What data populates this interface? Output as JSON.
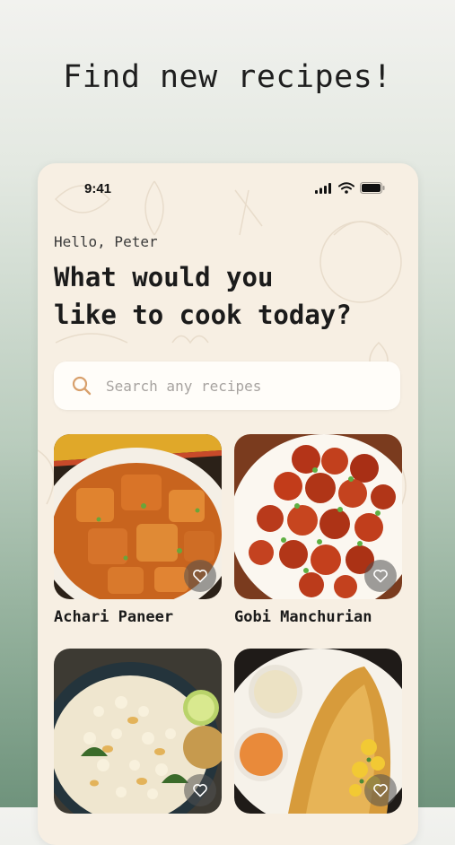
{
  "headline": "Find new recipes!",
  "status": {
    "time": "9:41"
  },
  "greeting": "Hello, Peter",
  "prompt_line1": "What would you",
  "prompt_line2": "like to cook today?",
  "search": {
    "placeholder": "Search any recipes"
  },
  "recipes": [
    {
      "name": "Achari Paneer"
    },
    {
      "name": "Gobi Manchurian"
    },
    {
      "name": ""
    },
    {
      "name": ""
    }
  ],
  "icons": {
    "search": "search-icon",
    "favorite": "heart-outline-icon",
    "signal": "cellular-signal-icon",
    "wifi": "wifi-icon",
    "battery": "battery-icon"
  },
  "colors": {
    "card_background": "#f7efe3",
    "search_icon": "#d8a06c",
    "text": "#1b1b1b"
  }
}
